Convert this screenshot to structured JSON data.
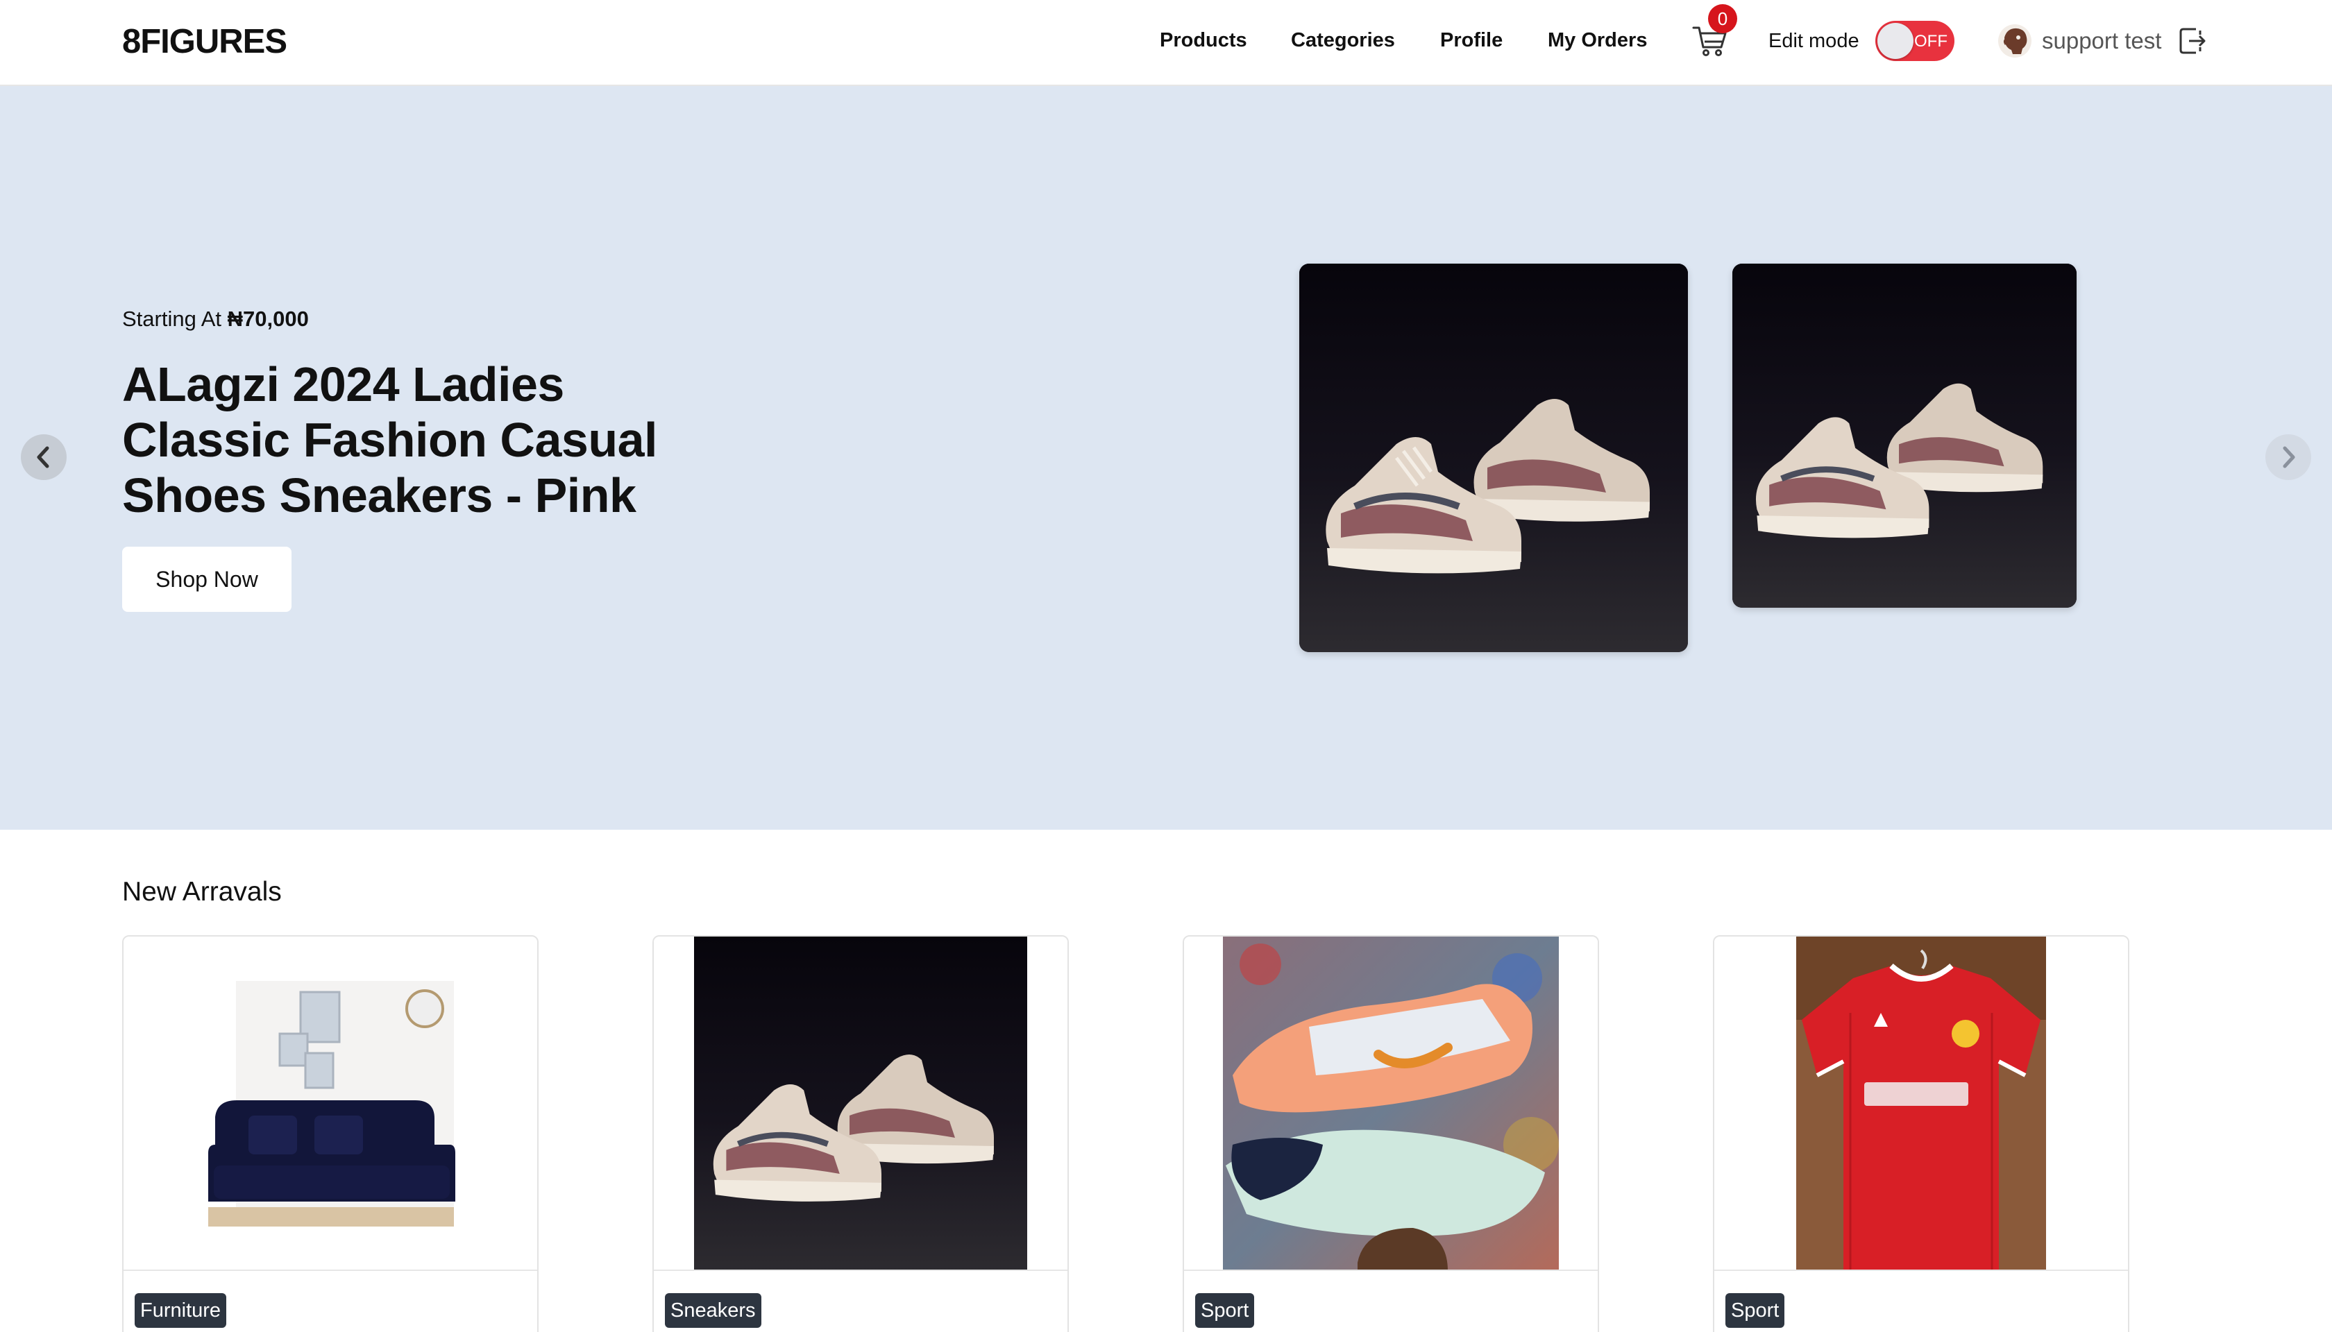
{
  "brand": "8FIGURES",
  "nav": {
    "products": "Products",
    "categories": "Categories",
    "profile": "Profile",
    "orders": "My Orders",
    "cart_count": "0",
    "edit_mode_label": "Edit mode",
    "edit_mode_state": "OFF",
    "user_name": "support test"
  },
  "hero": {
    "price_prefix": "Starting At ",
    "price": "₦70,000",
    "title": "ALagzi 2024 Ladies Classic Fashion Casual Shoes Sneakers - Pink",
    "cta": "Shop Now"
  },
  "new_arrivals": {
    "title": "New Arravals",
    "items": [
      {
        "category": "Furniture"
      },
      {
        "category": "Sneakers"
      },
      {
        "category": "Sport"
      },
      {
        "category": "Sport"
      }
    ]
  },
  "colors": {
    "hero_bg": "#dde6f2",
    "toggle_off": "#e8323e",
    "badge": "#d6151c",
    "tag_bg": "#2d3540"
  }
}
